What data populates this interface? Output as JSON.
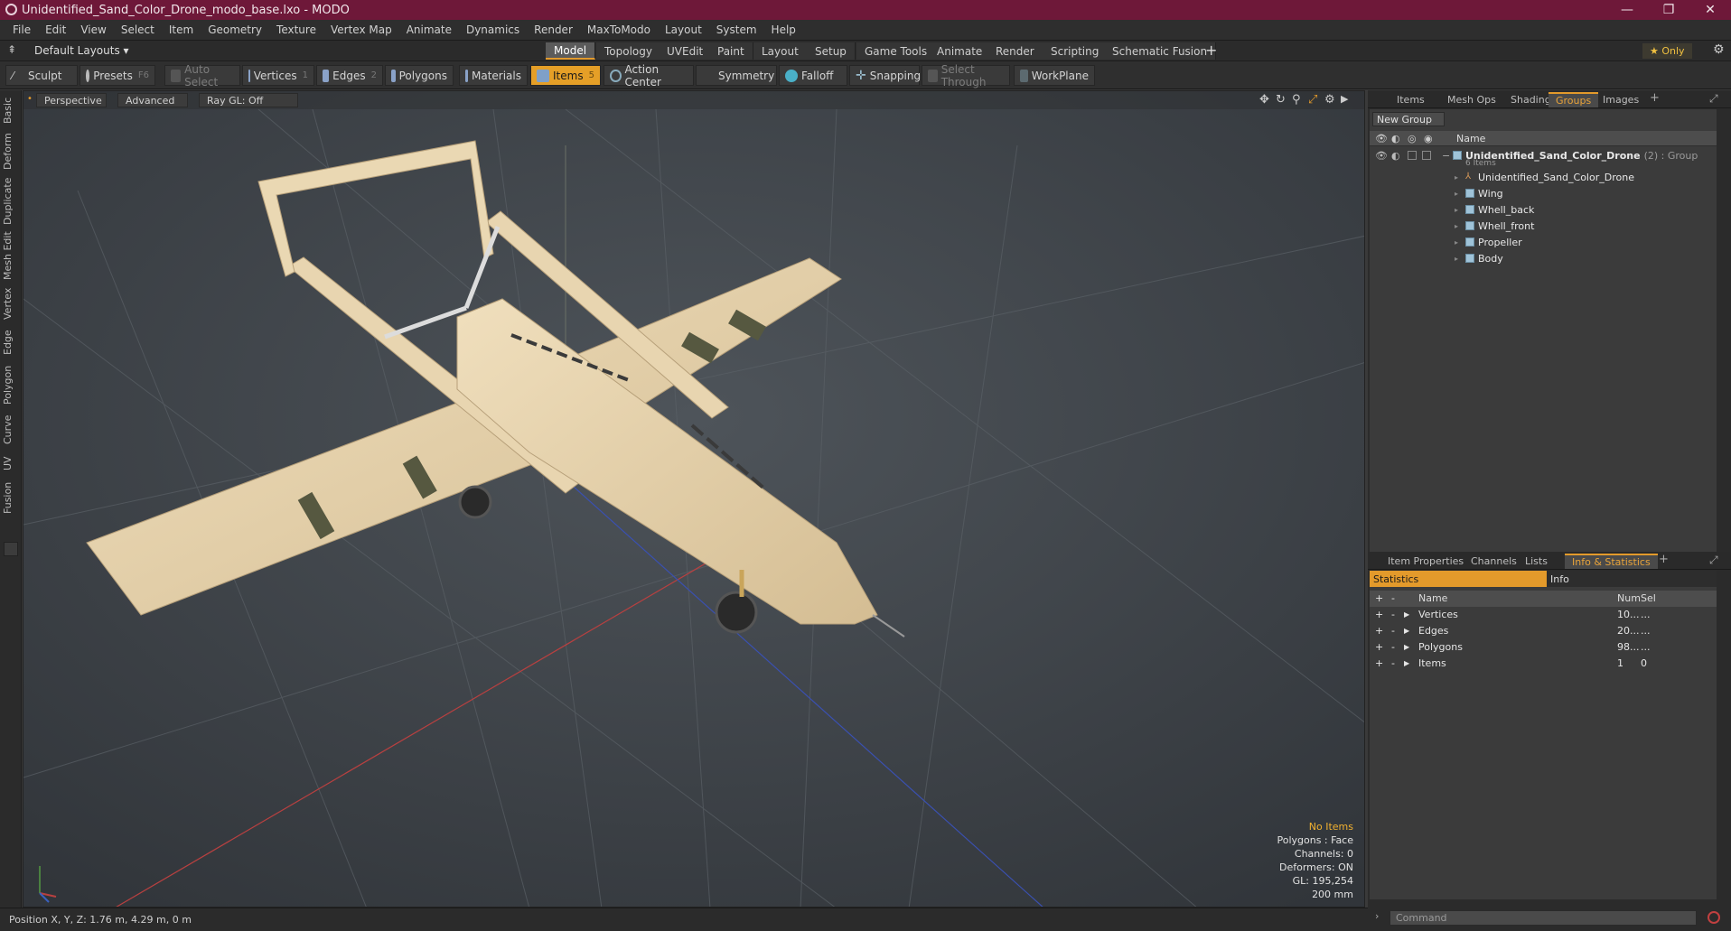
{
  "window": {
    "title": "Unidentified_Sand_Color_Drone_modo_base.lxo - MODO",
    "minimize": "—",
    "restore": "❐",
    "close": "✕"
  },
  "menu": [
    "File",
    "Edit",
    "View",
    "Select",
    "Item",
    "Geometry",
    "Texture",
    "Vertex Map",
    "Animate",
    "Dynamics",
    "Render",
    "MaxToModo",
    "Layout",
    "System",
    "Help"
  ],
  "layoutbar": {
    "layouts_label": "Default Layouts ▾",
    "tabs": [
      "Model",
      "Topology",
      "UVEdit",
      "Paint",
      "Layout",
      "Setup",
      "Game Tools",
      "Animate",
      "Render",
      "Scripting",
      "Schematic Fusion"
    ],
    "only_label": "★  Only"
  },
  "toolbar": {
    "sculpt": "Sculpt",
    "presets": "Presets",
    "presets_key": "F6",
    "auto_select": "Auto Select",
    "vertices": "Vertices",
    "vertices_num": "1",
    "edges": "Edges",
    "edges_num": "2",
    "polygons": "Polygons",
    "materials": "Materials",
    "items": "Items",
    "items_num": "5",
    "action_center": "Action Center",
    "symmetry": "Symmetry",
    "falloff": "Falloff",
    "snapping": "Snapping",
    "select_through": "Select Through",
    "workplane": "WorkPlane"
  },
  "left_tabs": [
    "Basic",
    "Deform",
    "Duplicate",
    "Mesh Edit",
    "Vertex",
    "Edge",
    "Polygon",
    "Curve",
    "UV",
    "Fusion"
  ],
  "viewport": {
    "perspective": "Perspective",
    "advanced": "Advanced",
    "raygl": "Ray GL: Off",
    "info": {
      "no_items": "No Items",
      "polygons": "Polygons : Face",
      "channels": "Channels: 0",
      "deformers": "Deformers: ON",
      "gl": "GL: 195,254",
      "scale": "200 mm"
    }
  },
  "status": {
    "position": "Position X, Y, Z:   1.76 m, 4.29 m, 0 m"
  },
  "groups_panel": {
    "tabs": [
      "Items",
      "Mesh Ops",
      "Shading",
      "Groups",
      "Images"
    ],
    "new_group": "New Group",
    "name_header": "Name",
    "group_name": "Unidentified_Sand_Color_Drone",
    "group_suffix": "(2) : Group",
    "group_count": "6 Items",
    "children": [
      "Unidentified_Sand_Color_Drone",
      "Wing",
      "Whell_back",
      "Whell_front",
      "Propeller",
      "Body"
    ]
  },
  "info_panel": {
    "tabs": [
      "Item Properties",
      "Channels",
      "Lists",
      "Info & Statistics"
    ],
    "statistics": "Statistics",
    "info": "Info",
    "headers": {
      "name": "Name",
      "num": "Num",
      "sel": "Sel"
    },
    "rows": [
      {
        "name": "Vertices",
        "num": "10...",
        "sel": "..."
      },
      {
        "name": "Edges",
        "num": "20...",
        "sel": "..."
      },
      {
        "name": "Polygons",
        "num": "98...",
        "sel": "..."
      },
      {
        "name": "Items",
        "num": "1",
        "sel": "0"
      }
    ]
  },
  "command": {
    "placeholder": "Command"
  },
  "colors": {
    "accent": "#e39a2b",
    "titlebar": "#6e1839",
    "drone": "#e6d2ad"
  }
}
